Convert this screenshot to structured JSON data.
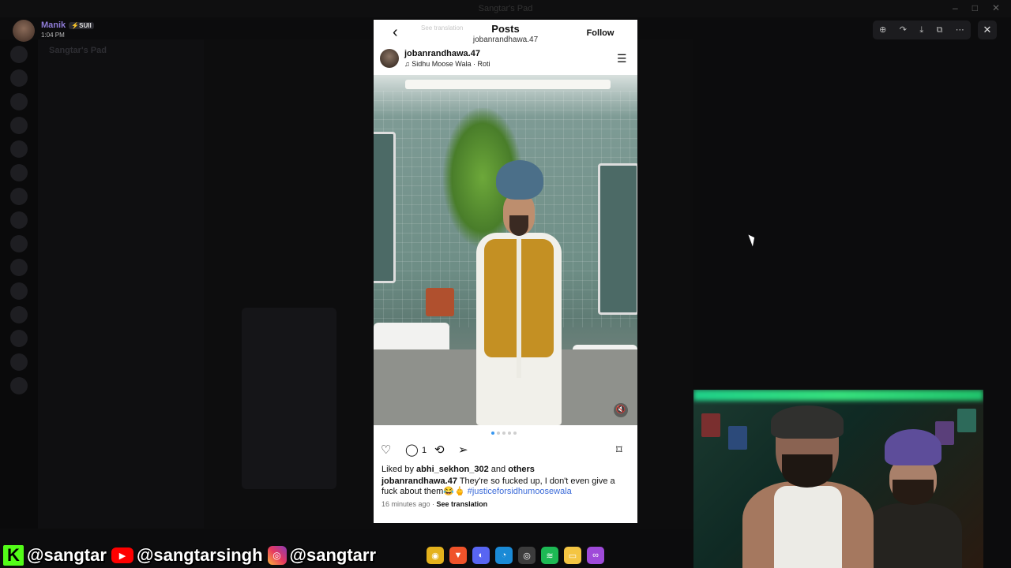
{
  "window": {
    "title": "Sangtar's Pad"
  },
  "discord": {
    "server_name": "Sangtar's Pad",
    "user": {
      "name": "Manik",
      "badge": "⚡SUII",
      "timestamp": "1:04 PM"
    }
  },
  "viewer_toolbar": {
    "icons": [
      "zoom-in-icon",
      "share-icon",
      "download-icon",
      "open-external-icon",
      "more-icon"
    ],
    "close_glyph": "✕"
  },
  "instagram": {
    "header": {
      "title": "Posts",
      "subtitle": "jobanrandhawa.47",
      "follow_label": "Follow",
      "ghost_text": "See translation"
    },
    "post": {
      "username": "jobanrandhawa.47",
      "music": "Sidhu Moose Wala · Roti",
      "comment_count": "1",
      "likes_prefix": "Liked by ",
      "likes_user": "abhi_sekhon_302",
      "likes_and": " and ",
      "likes_others": "others",
      "caption_user": "jobanrandhawa.47",
      "caption_text": " They're so fucked up, I don't even give a fuck about them😂🖕 ",
      "caption_hashtag": "#justiceforsidhumoosewala",
      "time_ago": "16 minutes ago",
      "see_translation": "See translation",
      "carousel_count": 5,
      "carousel_active": 1
    }
  },
  "overlay": {
    "kick_glyph": "K",
    "kick_handle": "@sangtar",
    "youtube_handle": "@sangtarsingh",
    "instagram_handle": "@sangtarr"
  },
  "taskbar": {
    "apps": [
      {
        "name": "chrome-icon",
        "color": "#e4b21c"
      },
      {
        "name": "brave-icon",
        "color": "#f0532a"
      },
      {
        "name": "discord-icon",
        "color": "#5865f2"
      },
      {
        "name": "edge-icon",
        "color": "#1a8ad6"
      },
      {
        "name": "obs-icon",
        "color": "#3c3c3c"
      },
      {
        "name": "spotify-icon",
        "color": "#1db954"
      },
      {
        "name": "files-icon",
        "color": "#f4c542"
      },
      {
        "name": "meta-icon",
        "color": "#9f4ad9"
      }
    ]
  },
  "colors": {
    "accent": "#3897f0",
    "username": "#8e7bd6",
    "hashtag": "#3a6ad8"
  }
}
